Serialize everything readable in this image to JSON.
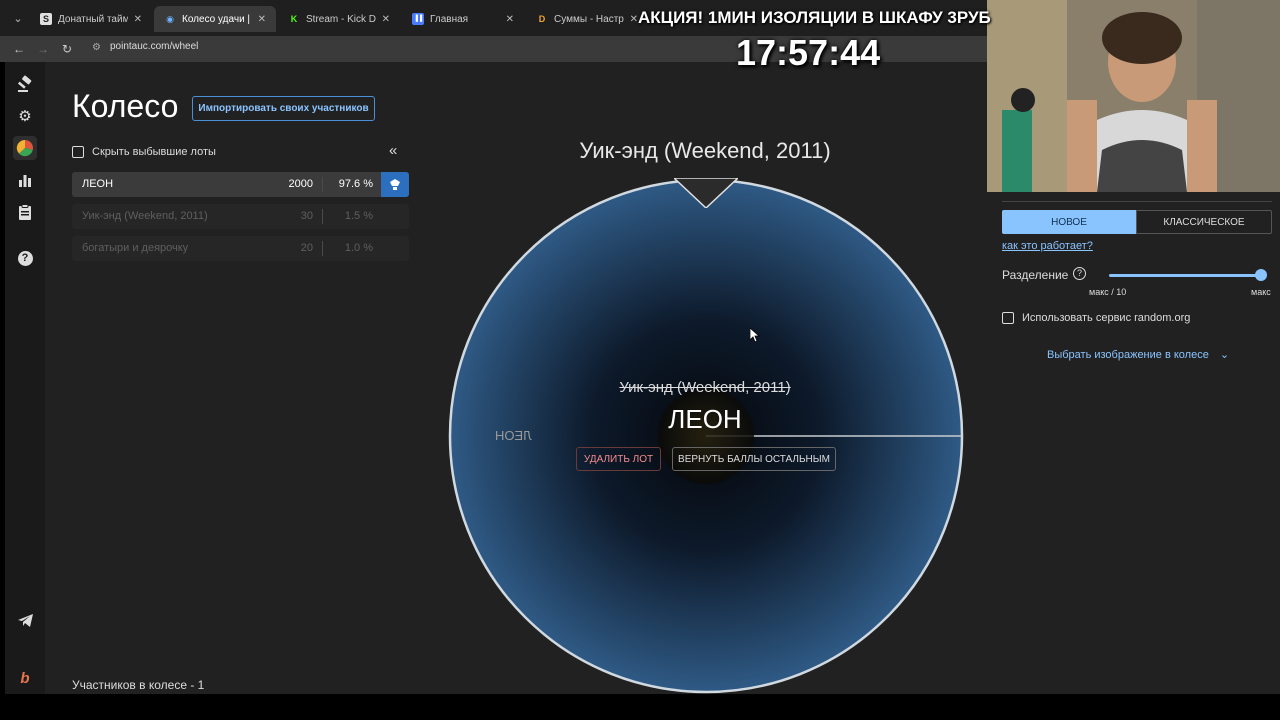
{
  "browser": {
    "tabs": [
      {
        "title": "Донатный таймер (н",
        "favicon": "S",
        "color": "#e0e0e0"
      },
      {
        "title": "Колесо удачи | Опре",
        "favicon": "◉",
        "color": "#6fb3ff",
        "active": true
      },
      {
        "title": "Stream - Kick Dashbo",
        "favicon": "K",
        "color": "#53fc18"
      },
      {
        "title": "Главная",
        "favicon": "▐▐",
        "color": "#4a7cff"
      },
      {
        "title": "Суммы - Настройки",
        "favicon": "D",
        "color": "#f2a33a"
      }
    ],
    "url": "pointauc.com/wheel"
  },
  "sidebar": {
    "icons": [
      "gavel-icon",
      "gear-icon",
      "wheel-icon",
      "stats-icon",
      "clipboard-icon",
      "help-icon",
      "telegram-icon",
      "brand-icon"
    ]
  },
  "header": {
    "title": "Колесо",
    "import_button": "Импортировать своих участников"
  },
  "lots_panel": {
    "hide_label": "Скрыть выбывшие лоты",
    "collapse_icon": "«",
    "lots": [
      {
        "name": "ЛЕОН",
        "amount": "2000",
        "percent": "97.6 %",
        "active": true
      },
      {
        "name": "Уик-энд (Weekend, 2011)",
        "amount": "30",
        "percent": "1.5 %",
        "active": false
      },
      {
        "name": "богатыри и деярочку",
        "amount": "20",
        "percent": "1.0 %",
        "active": false
      }
    ],
    "participants": "Участников в колесе - 1"
  },
  "wheel": {
    "title": "Уик-энд (Weekend, 2011)",
    "mirrored_label": "ЛЕОН",
    "center_eliminated": "Уик-энд (Weekend, 2011)",
    "center_winner": "ЛЕОН",
    "delete_button": "УДАЛИТЬ ЛОТ",
    "return_button": "ВЕРНУТЬ БАЛЛЫ ОСТАЛЬНЫМ",
    "colors": {
      "inner": "#070b12",
      "outer": "#2f5a85",
      "rim": "#d0d8e0"
    }
  },
  "settings": {
    "mode_new": "НОВОЕ",
    "mode_classic": "КЛАССИЧЕСКОЕ",
    "how_link": "как это работает?",
    "split_label": "Разделение",
    "split_min": "макс / 10",
    "split_max": "макс",
    "split_value": 1.0,
    "random_org": "Использовать сервис random.org",
    "image_picker": "Выбрать изображение в колесе"
  },
  "overlay": {
    "promo": "АКЦИЯ! 1МИН ИЗОЛЯЦИИ В ШКАФУ 3РУБ",
    "clock": "17:57:44"
  }
}
